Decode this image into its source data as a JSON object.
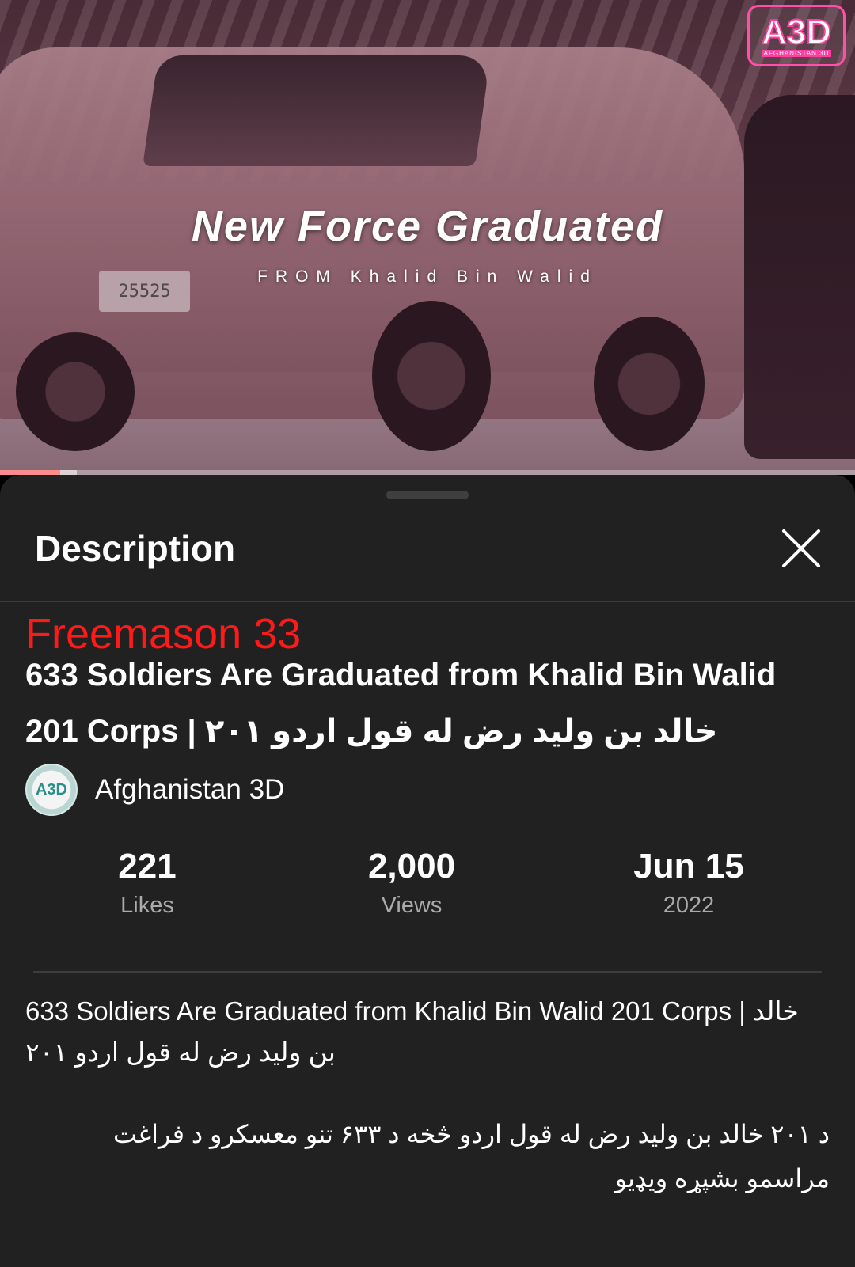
{
  "video": {
    "title_overlay": "New Force Graduated",
    "subtitle_overlay": "FROM Khalid Bin Walid",
    "plate_number": "25525",
    "logo_text": "A3D",
    "logo_subtext": "AFGHANISTAN 3D",
    "progress_fraction": 0.07
  },
  "sheet": {
    "title": "Description",
    "overlay_label": "Freemason 33",
    "video_heading": "633 Soldiers Are Graduated from Khalid Bin Walid 201 Corps | خالد بن ولید رض له قول اردو ۲۰۱",
    "channel": {
      "avatar_text": "A3D",
      "name": "Afghanistan 3D"
    },
    "stats": [
      {
        "value": "221",
        "label": "Likes"
      },
      {
        "value": "2,000",
        "label": "Views"
      },
      {
        "value": "Jun 15",
        "label": "2022"
      }
    ],
    "description_line": "633 Soldiers Are Graduated from Khalid Bin Walid 201 Corps | خالد بن ولید رض له قول اردو ۲۰۱",
    "description_rtl": "د ۲۰۱ خالد بن ولید رض له قول اردو څخه د ۶۳۳ تنو معسکرو د فراغت مراسمو بشپړه ویډیو"
  },
  "colors": {
    "sheet_bg": "#212121",
    "overlay_label": "#ff1a1a",
    "progress": "#ff0000",
    "secondary_text": "#aaaaaa"
  },
  "icons": [
    "close-icon"
  ]
}
